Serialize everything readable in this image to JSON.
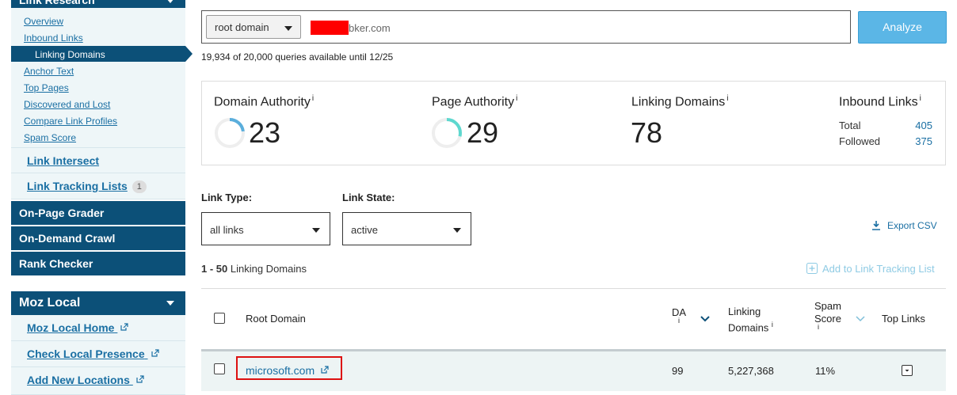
{
  "sidebar": {
    "link_research": {
      "title": "Link Research",
      "items": [
        {
          "label": "Overview"
        },
        {
          "label": "Inbound Links"
        },
        {
          "label": "Linking Domains",
          "active": true
        },
        {
          "label": "Anchor Text"
        },
        {
          "label": "Top Pages"
        },
        {
          "label": "Discovered and Lost"
        },
        {
          "label": "Compare Link Profiles"
        },
        {
          "label": "Spam Score"
        }
      ]
    },
    "link_intersect": "Link Intersect",
    "link_tracking_lists": {
      "label": "Link Tracking Lists",
      "badge": "1"
    },
    "on_page_grader": "On-Page Grader",
    "on_demand_crawl": "On-Demand Crawl",
    "rank_checker": "Rank Checker",
    "moz_local": {
      "title": "Moz Local",
      "items": [
        {
          "label": "Moz Local Home"
        },
        {
          "label": "Check Local Presence"
        },
        {
          "label": "Add New Locations"
        }
      ]
    }
  },
  "search": {
    "scope": "root domain",
    "query_visible": "bker.com",
    "analyze_label": "Analyze",
    "quota": "19,934 of 20,000 queries available until 12/25"
  },
  "metrics": {
    "domain_authority": {
      "label": "Domain Authority",
      "info": "i",
      "value": "23",
      "level": 0.23
    },
    "page_authority": {
      "label": "Page Authority",
      "info": "i",
      "value": "29",
      "level": 0.29
    },
    "linking_domains": {
      "label": "Linking Domains",
      "info": "i",
      "value": "78"
    },
    "inbound_links": {
      "label": "Inbound Links",
      "info": "i",
      "total_label": "Total",
      "total": "405",
      "followed_label": "Followed",
      "followed": "375"
    }
  },
  "filters": {
    "link_type_label": "Link Type:",
    "link_type_value": "all links",
    "link_state_label": "Link State:",
    "link_state_value": "active",
    "export_label": "Export CSV"
  },
  "results": {
    "range_bold": "1 - 50",
    "range_text": "Linking Domains",
    "add_tracking": "Add to Link Tracking List"
  },
  "table": {
    "headers": {
      "root_domain": "Root Domain",
      "da": "DA",
      "linking_domains_1": "Linking",
      "linking_domains_2": "Domains",
      "spam_1": "Spam",
      "spam_2": "Score",
      "top_links": "Top Links",
      "info": "i"
    },
    "rows": [
      {
        "domain": "microsoft.com",
        "da": "99",
        "linking_domains": "5,227,368",
        "spam_score": "11%"
      }
    ]
  },
  "colors": {
    "sidebar_dark": "#0c5078",
    "link": "#1a6fa3",
    "analyze": "#5bb6e6",
    "ring_da": "#5aaedc",
    "ring_pa": "#5ed8cf",
    "highlight": "#dd1111"
  }
}
